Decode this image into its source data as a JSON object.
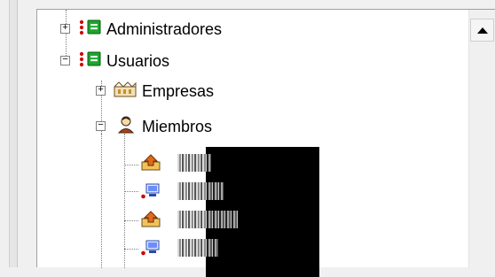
{
  "tree": {
    "items": [
      {
        "label": "Administradores",
        "icon": "group-node-icon"
      },
      {
        "label": "Usuarios",
        "icon": "group-node-icon"
      },
      {
        "label": "Empresas",
        "icon": "companies-icon"
      },
      {
        "label": "Miembros",
        "icon": "member-person-icon"
      }
    ],
    "children_icons": [
      "upload-user-icon",
      "computer-user-icon",
      "upload-user-icon",
      "computer-user-icon"
    ]
  },
  "scrollbar": {
    "up_arrow": "scroll-up-icon"
  }
}
